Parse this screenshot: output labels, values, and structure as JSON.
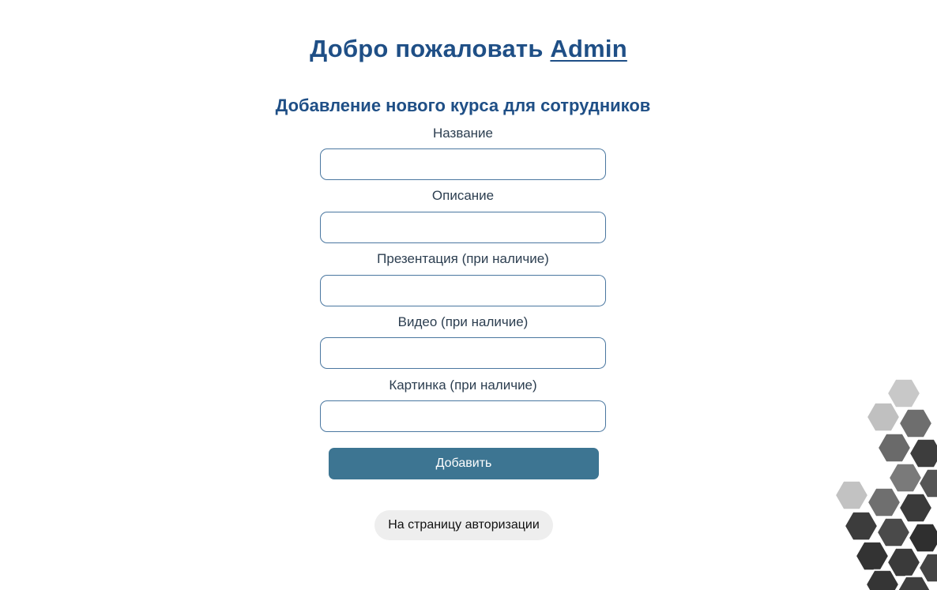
{
  "header": {
    "welcome_prefix": "Добро пожаловать",
    "username": "Admin"
  },
  "form": {
    "title": "Добавление нового курса для сотрудников",
    "fields": [
      {
        "label": "Название",
        "value": ""
      },
      {
        "label": "Описание",
        "value": ""
      },
      {
        "label": "Презентация (при наличие)",
        "value": ""
      },
      {
        "label": "Видео (при наличие)",
        "value": ""
      },
      {
        "label": "Картинка (при наличие)",
        "value": ""
      }
    ],
    "submit_label": "Добавить"
  },
  "footer": {
    "auth_link_label": "На страницу авторизации"
  },
  "colors": {
    "heading": "#1f4f86",
    "submit_bg": "#3d7592",
    "input_border": "#4a77a0",
    "auth_bg": "#eeeeee"
  },
  "decoration": {
    "icon": "hexagon-pattern"
  }
}
